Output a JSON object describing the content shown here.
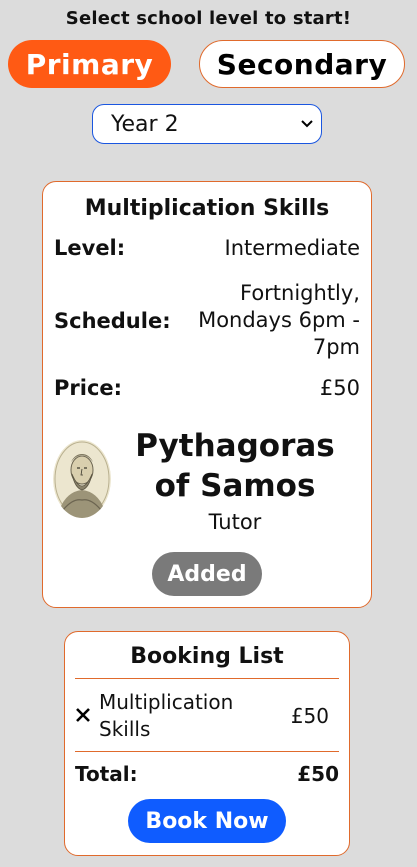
{
  "prompt": "Select school level to start!",
  "levels": {
    "primary": "Primary",
    "secondary": "Secondary"
  },
  "year_select": {
    "value": "Year 2"
  },
  "course": {
    "title": "Multiplication Skills",
    "level_label": "Level:",
    "level_value": "Intermediate",
    "schedule_label": "Schedule:",
    "schedule_value": "Fortnightly, Mondays 6pm - 7pm",
    "price_label": "Price:",
    "price_value": "£50",
    "tutor_name": "Pythagoras of Samos",
    "tutor_role": "Tutor",
    "action_label": "Added"
  },
  "booking": {
    "title": "Booking List",
    "items": [
      {
        "name": "Multiplication Skills",
        "price": "£50"
      }
    ],
    "remove_glyph": "✕",
    "total_label": "Total:",
    "total_value": "£50",
    "book_label": "Book Now"
  },
  "colors": {
    "accent": "#ff5a14",
    "border": "#e06a2c",
    "book_blue": "#0f5cff",
    "added_grey": "#7a7a7a",
    "background": "#dcdcdc"
  }
}
